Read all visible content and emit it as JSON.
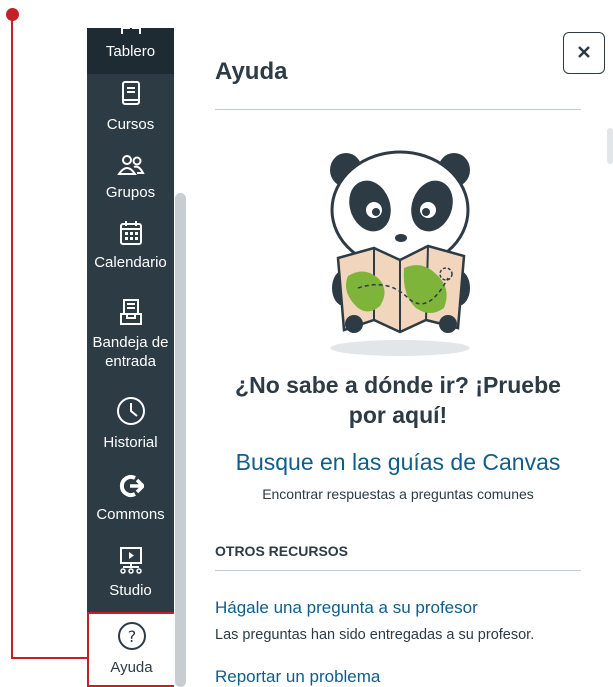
{
  "nav": {
    "items": [
      {
        "label": "Tablero",
        "icon": "dashboard-icon"
      },
      {
        "label": "Cursos",
        "icon": "courses-icon"
      },
      {
        "label": "Grupos",
        "icon": "groups-icon"
      },
      {
        "label": "Calendario",
        "icon": "calendar-icon"
      },
      {
        "label": "Bandeja de entrada",
        "icon": "inbox-icon"
      },
      {
        "label": "Historial",
        "icon": "history-icon"
      },
      {
        "label": "Commons",
        "icon": "commons-icon"
      },
      {
        "label": "Studio",
        "icon": "studio-icon"
      },
      {
        "label": "Ayuda",
        "icon": "help-icon"
      }
    ]
  },
  "tray": {
    "title": "Ayuda",
    "close_icon": "close-icon",
    "headline": "¿No sabe a dónde ir? ¡Pruebe por aquí!",
    "guides_link": "Busque en las guías de Canvas",
    "guides_sub": "Encontrar respuestas a preguntas comunes",
    "section_heading": "OTROS RECURSOS",
    "resources": [
      {
        "link": "Hágale una pregunta a su profesor",
        "sub": "Las preguntas han sido entregadas a su profesor."
      },
      {
        "link": "Reportar un problema"
      }
    ]
  },
  "colors": {
    "nav_bg": "#2d3b45",
    "link": "#0f5d8a",
    "annotation": "#c51f2a"
  }
}
